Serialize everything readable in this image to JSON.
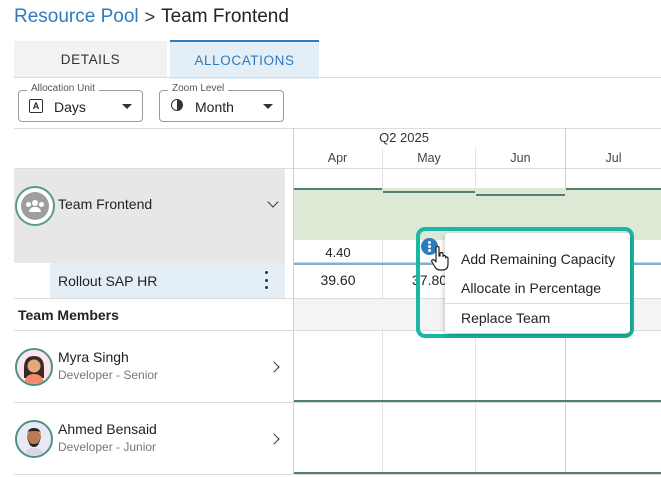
{
  "breadcrumb": {
    "parent": "Resource Pool",
    "separator": ">",
    "current": "Team Frontend"
  },
  "tabs": [
    {
      "label": "DETAILS"
    },
    {
      "label": "ALLOCATIONS"
    }
  ],
  "filters": {
    "allocation_unit": {
      "label": "Allocation Unit",
      "value": "Days"
    },
    "zoom_level": {
      "label": "Zoom Level",
      "value": "Month"
    }
  },
  "timeline": {
    "quarter": "Q2 2025",
    "months": [
      "Apr",
      "May",
      "Jun",
      "Jul"
    ]
  },
  "team": {
    "name": "Team Frontend",
    "remaining_apr": "4.40"
  },
  "project": {
    "name": "Rollout SAP HR",
    "apr": "39.60",
    "may": "37.80"
  },
  "section_title": "Team Members",
  "members": [
    {
      "name": "Myra Singh",
      "role": "Developer - Senior"
    },
    {
      "name": "Ahmed Bensaid",
      "role": "Developer - Junior"
    }
  ],
  "context_menu": {
    "items": [
      "Add Remaining Capacity",
      "Allocate in Percentage",
      "Replace Team"
    ]
  },
  "colors": {
    "accent": "#2d7bbd",
    "highlight": "#19b7a4",
    "capacity_fill": "#dde8d5"
  }
}
